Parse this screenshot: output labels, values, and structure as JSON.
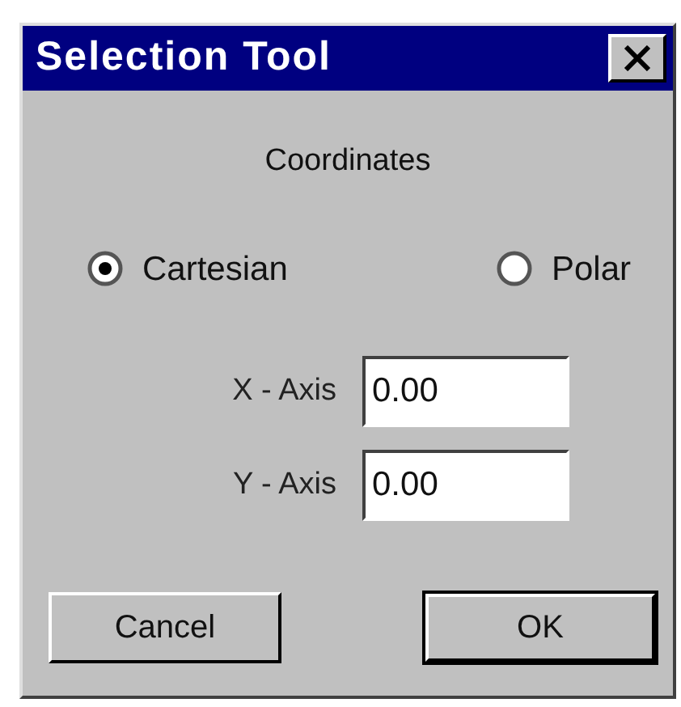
{
  "window": {
    "title": "Selection Tool"
  },
  "heading": "Coordinates",
  "options": [
    {
      "label": "Cartesian",
      "selected": true
    },
    {
      "label": "Polar",
      "selected": false
    }
  ],
  "fields": [
    {
      "label": "X - Axis",
      "value": "0.00"
    },
    {
      "label": "Y - Axis",
      "value": "0.00"
    }
  ],
  "buttons": [
    {
      "label": "Cancel",
      "default": false
    },
    {
      "label": "OK",
      "default": true
    }
  ]
}
